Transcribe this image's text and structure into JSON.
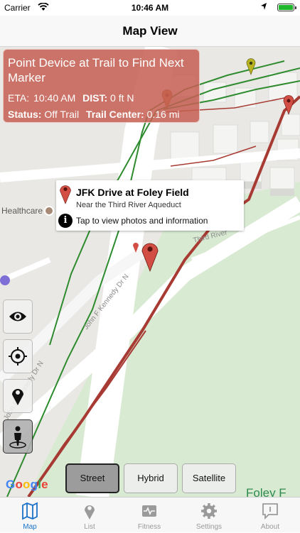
{
  "status_bar": {
    "carrier": "Carrier",
    "time": "10:46 AM",
    "battery_level": 1.0
  },
  "nav": {
    "title": "Map View"
  },
  "info_panel": {
    "title": "Point Device at Trail to Find Next Marker",
    "eta_label": "ETA:",
    "eta_value": "10:40 AM",
    "dist_label": "DIST:",
    "dist_value": "0 ft N",
    "status_label": "Status:",
    "status_value": "Off Trail",
    "center_label": "Trail Center:",
    "center_value": "0.16 mi"
  },
  "callout": {
    "title": "JFK Drive at Foley Field",
    "subtitle": "Near the Third River Aqueduct",
    "info_text": "Tap to view photos and information"
  },
  "map_labels": {
    "healthcare": "Healthcare",
    "third_river": "Third River",
    "jfk_drive": "John F Kennedy Dr N",
    "jfk_drive_2": "John F Kennedy Dr N",
    "foley": "Foley F"
  },
  "map_type": {
    "options": [
      "Street",
      "Hybrid",
      "Satellite"
    ],
    "selected": "Street"
  },
  "google_logo": "Google",
  "tabs": [
    {
      "label": "Map",
      "icon": "map-icon",
      "active": true
    },
    {
      "label": "List",
      "icon": "pin-icon",
      "active": false
    },
    {
      "label": "Fitness",
      "icon": "heartbeat-icon",
      "active": false
    },
    {
      "label": "Settings",
      "icon": "gear-icon",
      "active": false
    },
    {
      "label": "About",
      "icon": "speech-bubble-icon",
      "active": false
    }
  ],
  "colors": {
    "info_panel": "#c66054",
    "trail_red": "#a73a32",
    "trail_green": "#2e8b2e",
    "tab_active": "#1a73c8"
  }
}
